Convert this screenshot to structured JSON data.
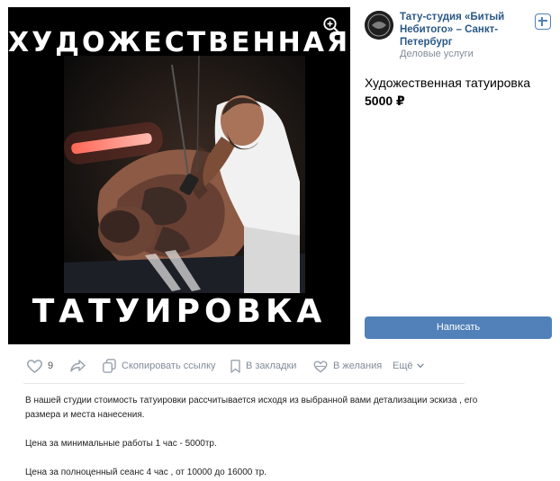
{
  "media": {
    "title_top": "ХУДОЖЕСТВЕННАЯ",
    "title_bottom": "ТАТУИРОВКА",
    "zoom_icon": "zoom-in-icon"
  },
  "shop": {
    "name": "Тату-студия «Битый Небитого» – Санкт-Петербург",
    "category": "Деловые услуги",
    "add_icon": "plus-square-icon"
  },
  "product": {
    "title": "Художественная татуировка",
    "price": "5000 ₽"
  },
  "buttons": {
    "write": "Написать"
  },
  "actions": {
    "likes": "9",
    "copy_link": "Скопировать ссылку",
    "bookmarks": "В закладки",
    "wishlist": "В желания",
    "more": "Ещё"
  },
  "description": [
    "В нашей студии стоимость татуировки рассчитывается исходя из выбранной вами детализации эскиза , его размера и места нанесения.",
    "Цена за минимальные работы 1 час - 5000тр.",
    "Цена за полноценный сеанс 4 час , от 10000 до 16000 тр."
  ],
  "colors": {
    "accent": "#5181b8",
    "link": "#2a5885",
    "muted": "#818c99"
  }
}
